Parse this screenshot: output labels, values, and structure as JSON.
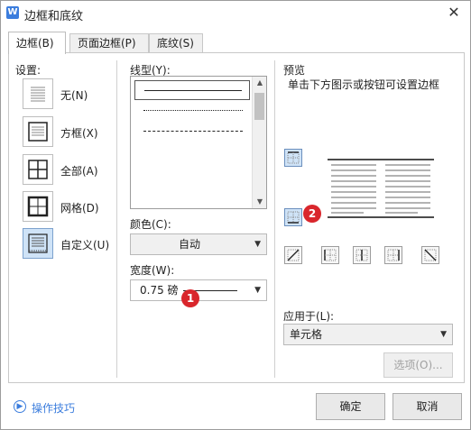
{
  "window": {
    "title": "边框和底纹",
    "close_label": "✕"
  },
  "tabs": [
    {
      "label": "边框(B)",
      "active": true
    },
    {
      "label": "页面边框(P)",
      "active": false
    },
    {
      "label": "底纹(S)",
      "active": false
    }
  ],
  "settings": {
    "heading": "设置:",
    "items": [
      {
        "label": "无(N)",
        "icon": "none-border-icon",
        "selected": false
      },
      {
        "label": "方框(X)",
        "icon": "box-border-icon",
        "selected": false
      },
      {
        "label": "全部(A)",
        "icon": "all-borders-icon",
        "selected": false
      },
      {
        "label": "网格(D)",
        "icon": "grid-border-icon",
        "selected": false
      },
      {
        "label": "自定义(U)",
        "icon": "custom-border-icon",
        "selected": true
      }
    ]
  },
  "line_style": {
    "heading": "线型(Y):",
    "options": [
      "solid",
      "dotted-fine",
      "dash-small",
      "dash-medium",
      "dash-dot",
      "dash-dot-dot"
    ],
    "selected_index": 0
  },
  "color": {
    "heading": "颜色(C):",
    "value": "自动"
  },
  "width": {
    "heading": "宽度(W):",
    "value": "0.75 磅"
  },
  "preview": {
    "heading": "预览",
    "hint": "单击下方图示或按钮可设置边框"
  },
  "apply_to": {
    "heading": "应用于(L):",
    "value": "单元格"
  },
  "options_button": "选项(O)...",
  "help_text": "操作技巧",
  "ok_button": "确定",
  "cancel_button": "取消",
  "badges": [
    "1",
    "2"
  ],
  "colors": {
    "accent": "#3b7ddd",
    "badge": "#d9262c",
    "selected_bg": "#cfe3f7"
  }
}
